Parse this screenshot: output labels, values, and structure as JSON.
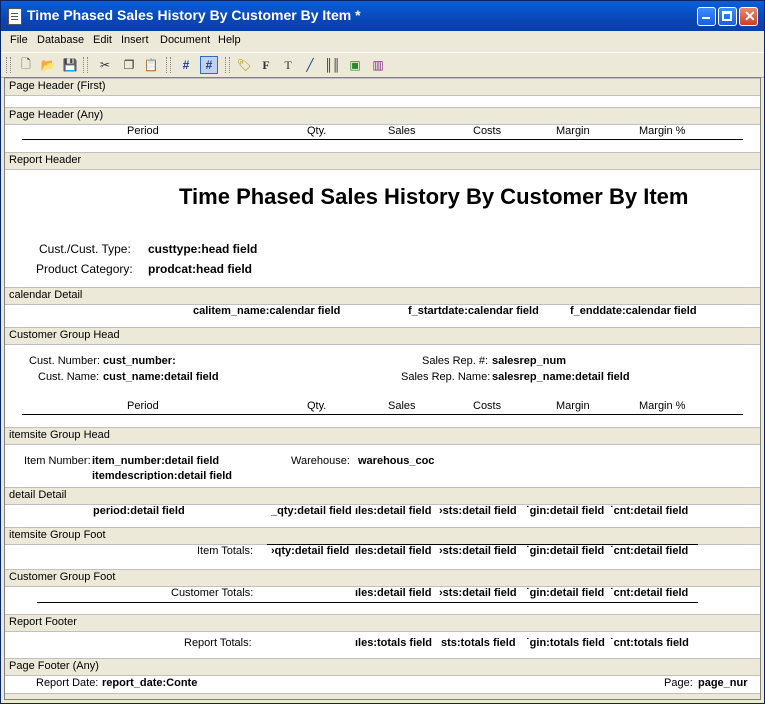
{
  "window": {
    "title": "Time Phased Sales History By Customer By Item *"
  },
  "menu": [
    "File",
    "Database",
    "Edit",
    "Insert",
    "Document",
    "Help"
  ],
  "toolbar": {
    "icons": [
      "new-icon",
      "open-icon",
      "save-icon",
      "cut-icon",
      "copy-icon",
      "paste-icon",
      "grid-icon",
      "snap-grid-icon",
      "label-icon",
      "field-icon",
      "text-icon",
      "line-icon",
      "barcode-icon",
      "image-icon",
      "graph-icon"
    ]
  },
  "bands": {
    "page_header_first": "Page Header (First)",
    "page_header_any": "Page Header (Any)",
    "report_header": "Report Header",
    "calendar_detail": "calendar Detail",
    "customer_group_head": "Customer Group Head",
    "itemsite_group_head": "itemsite Group Head",
    "detail_detail": "detail Detail",
    "itemsite_group_foot": "itemsite Group Foot",
    "customer_group_foot": "Customer Group Foot",
    "report_footer": "Report Footer",
    "page_footer_any": "Page Footer (Any)"
  },
  "columns": {
    "period": "Period",
    "qty": "Qty.",
    "sales": "Sales",
    "costs": "Costs",
    "margin": "Margin",
    "margin_pct": "Margin %"
  },
  "report_header": {
    "title": "Time Phased Sales History By Customer By Item",
    "custtype_label": "Cust./Cust. Type:",
    "custtype_field": "custtype:head field",
    "prodcat_label": "Product Category:",
    "prodcat_field": "prodcat:head field"
  },
  "calendar_detail": {
    "calitem": "calitem_name:calendar field",
    "startdate": "f_startdate:calendar field",
    "enddate": "f_enddate:calendar field"
  },
  "customer_head": {
    "cust_number_label": "Cust. Number:",
    "cust_number_field": "cust_number:",
    "cust_name_label": "Cust. Name:",
    "cust_name_field": "cust_name:detail field",
    "salesrep_label": "Sales Rep. #:",
    "salesrep_field": "salesrep_num",
    "salesrep_name_label": "Sales Rep. Name:",
    "salesrep_name_field": "salesrep_name:detail field"
  },
  "itemsite_head": {
    "item_number_label": "Item Number:",
    "item_number_field": "item_number:detail field",
    "item_desc_field": "itemdescription:detail field",
    "warehouse_label": "Warehouse:",
    "warehouse_field": "warehous_coc"
  },
  "detail": {
    "period": "period:detail field",
    "qty": "_qty:detail field",
    "sales": "ıles:detail field",
    "costs": "›sts:detail field",
    "margin": "˙gin:detail field",
    "pct": "˙cnt:detail field"
  },
  "itemsite_foot": {
    "label": "Item Totals:",
    "qty": "›qty:detail field",
    "sales": "ıles:detail field",
    "costs": "›sts:detail field",
    "margin": "˙gin:detail field",
    "pct": "˙cnt:detail field"
  },
  "customer_foot": {
    "label": "Customer Totals:",
    "sales": "ıles:detail field",
    "costs": "›sts:detail field",
    "margin": "˙gin:detail field",
    "pct": "˙cnt:detail field"
  },
  "report_footer": {
    "label": "Report Totals:",
    "sales": "ıles:totals field",
    "costs": "sts:totals field",
    "margin": "˙gin:totals field",
    "pct": "˙cnt:totals field"
  },
  "page_footer": {
    "report_date_label": "Report Date:",
    "report_date_field": "report_date:Conte",
    "page_label": "Page:",
    "page_field": "page_nur"
  }
}
